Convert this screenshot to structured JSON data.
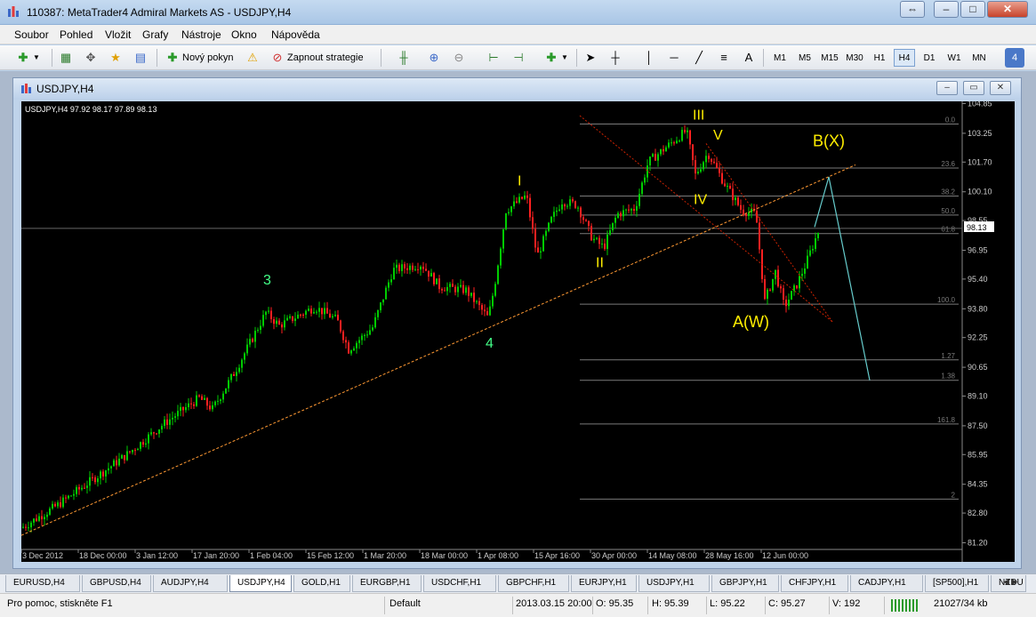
{
  "window": {
    "title": "110387: MetaTrader4 Admiral Markets AS - USDJPY,H4"
  },
  "menu": [
    "Soubor",
    "Pohled",
    "Vložit",
    "Grafy",
    "Nástroje",
    "Okno",
    "Nápověda"
  ],
  "toolbar": {
    "new_order": "Nový pokyn",
    "autotrading": "Zapnout strategie",
    "timeframes": [
      "M1",
      "M5",
      "M15",
      "M30",
      "H1",
      "H4",
      "D1",
      "W1",
      "MN"
    ],
    "active_timeframe": "H4",
    "text_tool": "A",
    "badge_count": "4"
  },
  "chart": {
    "window_title": "USDJPY,H4",
    "info_line": "USDJPY,H4  97.92 98.17 97.89 98.13",
    "price_levels": [
      "104.85",
      "103.25",
      "101.70",
      "100.10",
      "98.55",
      "96.95",
      "95.40",
      "93.80",
      "92.25",
      "90.65",
      "89.10",
      "87.50",
      "85.95",
      "84.35",
      "82.80",
      "81.20"
    ],
    "current_price": "98.13",
    "date_labels": [
      "3 Dec 2012",
      "18 Dec 00:00",
      "3 Jan 12:00",
      "17 Jan 20:00",
      "1 Feb 04:00",
      "15 Feb 12:00",
      "1 Mar 20:00",
      "18 Mar 00:00",
      "1 Apr 08:00",
      "15 Apr 16:00",
      "30 Apr 00:00",
      "14 May 08:00",
      "28 May 16:00",
      "12 Jun 00:00"
    ],
    "fib_labels": [
      "0.0",
      "23.6",
      "38.2",
      "50.0",
      "61.8",
      "100.0",
      "1.27",
      "1.38",
      "161.8",
      "2"
    ],
    "wave_labels_green": [
      "3",
      "4"
    ],
    "wave_labels_yellow": [
      "I",
      "II",
      "III",
      "IV",
      "V",
      "A(W)",
      "B(X)"
    ],
    "colors": {
      "background": "#000000",
      "bull_candle": "#00cc00",
      "bear_candle": "#ff2020",
      "trendline": "#ff9933",
      "fib": "#7a7a7a",
      "channel": "#cc2200",
      "projection": "#66cccc",
      "wave_green": "#44ff88",
      "wave_yellow": "#ffee00"
    }
  },
  "tabs": [
    "EURUSD,H4",
    "GBPUSD,H4",
    "AUDJPY,H4",
    "USDJPY,H4",
    "GOLD,H1",
    "EURGBP,H1",
    "USDCHF,H1",
    "GBPCHF,H1",
    "EURJPY,H1",
    "USDJPY,H1",
    "GBPJPY,H1",
    "CHFJPY,H1",
    "CADJPY,H1",
    "[SP500],H1",
    "NZDU"
  ],
  "active_tab": "USDJPY,H4",
  "status": {
    "help": "Pro pomoc, stiskněte F1",
    "profile": "Default",
    "datetime": "2013.03.15 20:00",
    "open": "O: 95.35",
    "high": "H: 95.39",
    "low": "L: 95.22",
    "close": "C: 95.27",
    "volume": "V: 192",
    "traffic": "21027/34 kb"
  }
}
